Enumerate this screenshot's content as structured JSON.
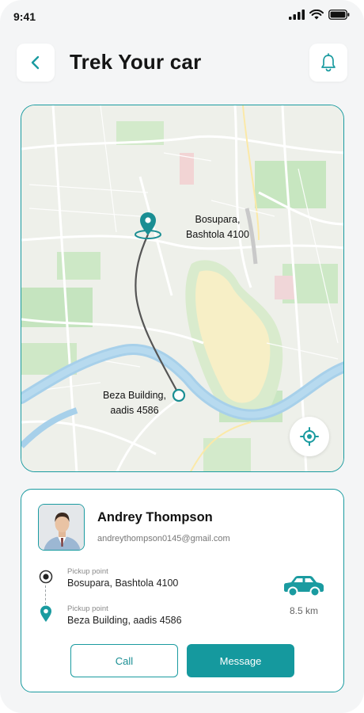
{
  "status_bar": {
    "time": "9:41"
  },
  "header": {
    "title": "Trek Your car",
    "back_icon": "chevron-left-icon",
    "bell_icon": "bell-icon"
  },
  "map": {
    "pickup_label": "Bosupara,\nBashtola 4100",
    "drop_label": "Beza Building,\naadis 4586",
    "locate_icon": "crosshair-icon"
  },
  "driver": {
    "name": "Andrey Thompson",
    "email": "andreythompson0145@gmail.com"
  },
  "trip": {
    "pickup_caption": "Pickup point",
    "pickup_address": "Bosupara, Bashtola 4100",
    "drop_caption": "Pickup point",
    "drop_address": "Beza Building, aadis 4586",
    "distance": "8.5 km"
  },
  "actions": {
    "call_label": "Call",
    "message_label": "Message"
  },
  "colors": {
    "accent": "#1a9ba0",
    "background": "#f4f5f6"
  }
}
